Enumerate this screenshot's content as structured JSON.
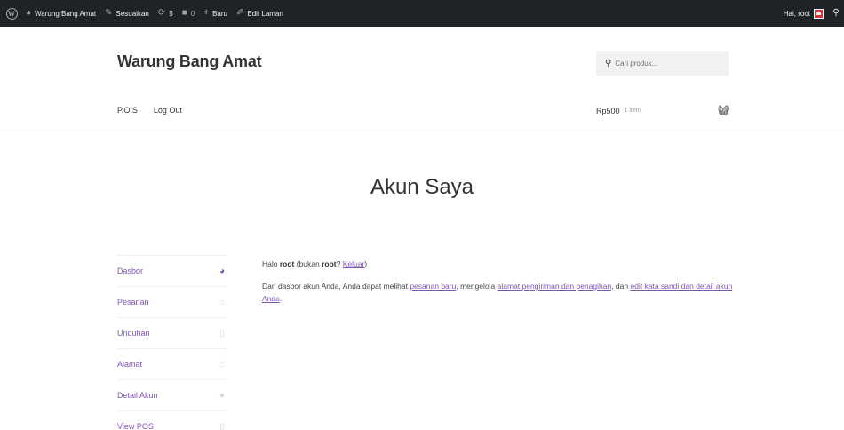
{
  "adminbar": {
    "wp_logo": "W",
    "site_name": "Warung Bang Amat",
    "customize": "Sesuaikan",
    "updates_count": "5",
    "comments_count": "0",
    "new_label": "Baru",
    "edit_page": "Edit Laman",
    "greeting": "Hai, root"
  },
  "header": {
    "site_title": "Warung Bang Amat",
    "search_placeholder": "Cari produk...",
    "nav": [
      "P.O.S",
      "Log Out"
    ],
    "cart_total": "Rp500",
    "cart_count": "1 item"
  },
  "page": {
    "title": "Akun Saya"
  },
  "account_nav": [
    {
      "label": "Dasbor",
      "icon": "dashboard-icon"
    },
    {
      "label": "Pesanan",
      "icon": "basket-icon"
    },
    {
      "label": "Unduhan",
      "icon": "file-icon"
    },
    {
      "label": "Alamat",
      "icon": "home-icon"
    },
    {
      "label": "Detail Akun",
      "icon": "user-icon"
    },
    {
      "label": "View POS",
      "icon": "file-icon"
    }
  ],
  "content": {
    "hello_prefix": "Halo ",
    "user": "root",
    "not_prefix": " (bukan ",
    "user2": "root",
    "q": "? ",
    "logout_link": "Keluar",
    "close": ")",
    "p2_a": "Dari dasbor akun Anda, Anda dapat melihat ",
    "link_orders": "pesanan baru",
    "p2_b": ", mengelola ",
    "link_address": "alamat pengiriman dan penagihan",
    "p2_c": ", dan ",
    "link_account": "edit kata sandi dan detail akun Anda",
    "p2_d": "."
  },
  "colors": {
    "accent": "#7f54b3",
    "adminbar_bg": "#1d2327"
  }
}
